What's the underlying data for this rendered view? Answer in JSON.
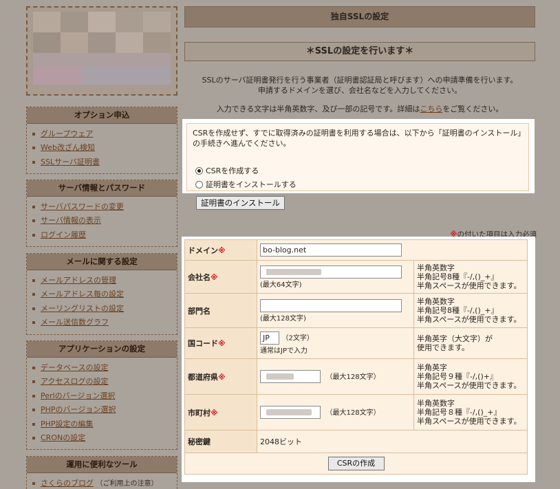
{
  "main": {
    "title": "独自SSLの設定",
    "subtitle": "＊SSLの設定を行います＊",
    "intro_line1": "SSLのサーバ証明書発行を行う事業者（証明書認証局と呼びます）への申請準備を行います。",
    "intro_line2": "申請するドメインを選び、会社名などを入力してください。",
    "chars_text": "入力できる文字は半角英数字、及び一部の記号です。詳細は",
    "chars_link": "こちら",
    "chars_suffix": "をご覧ください。"
  },
  "csr_option": {
    "description": "CSRを作成せず、すでに取得済みの証明書を利用する場合は、以下から「証明書のインストール」の手続きへ進んでください。",
    "radio_create": "CSRを作成する",
    "radio_install": "証明書をインストールする",
    "selected": "create",
    "install_button": "証明書のインストール"
  },
  "form": {
    "required_mark": "※",
    "required_note": "の付いた項目は入力必須",
    "domain_label": "ドメイン",
    "domain_value": "bo-blog.net",
    "company_label": "会社名",
    "company_hint": "(最大64文字)",
    "company_note": [
      "半角英数字",
      "半角記号8種『-/,()_+』",
      "半角スペースが使用できます。"
    ],
    "dept_label": "部門名",
    "dept_hint": "(最大128文字)",
    "dept_note": [
      "半角英数字",
      "半角記号8種『-/,()_+』",
      "半角スペースが使用できます。"
    ],
    "country_label": "国コード",
    "country_value": "JP",
    "country_hint": "（2文字）",
    "country_hint2": "通常はJPで入力",
    "country_note": [
      "半角英字（大文字）が",
      "使用できます。"
    ],
    "pref_label": "都道府県",
    "pref_hint": "（最大128文字）",
    "pref_note": [
      "半角英字",
      "半角記号９種『-/,()+』",
      "半角スペースが使用できます。"
    ],
    "city_label": "市町村",
    "city_hint": "（最大128文字）",
    "city_note": [
      "半角英数字",
      "半角記号８種『-/,()_+』",
      "半角スペースが使用できます。"
    ],
    "key_label": "秘密鍵",
    "key_value": "2048ビット",
    "csr_button": "CSRの作成"
  },
  "sidebar": {
    "sections": [
      {
        "title": "オプション申込",
        "items": [
          "グループウェア",
          "Web改ざん検知",
          "SSLサーバ証明書"
        ]
      },
      {
        "title": "サーバ情報とパスワード",
        "items": [
          "サーバパスワードの変更",
          "サーバ情報の表示",
          "ログイン履歴"
        ]
      },
      {
        "title": "メールに関する設定",
        "items": [
          "メールアドレスの管理",
          "メールアドレス毎の設定",
          "メーリングリストの設定",
          "メール送信数グラフ"
        ]
      },
      {
        "title": "アプリケーションの設定",
        "items": [
          "データベースの設定",
          "アクセスログの設定",
          "Perlのバージョン選択",
          "PHPのバージョン選択",
          "PHP設定の編集",
          "CRONの設定"
        ]
      },
      {
        "title": "運用に便利なツール",
        "items": [
          "さくらのブログ"
        ],
        "extra": "（ご利用上の注意）"
      }
    ]
  }
}
